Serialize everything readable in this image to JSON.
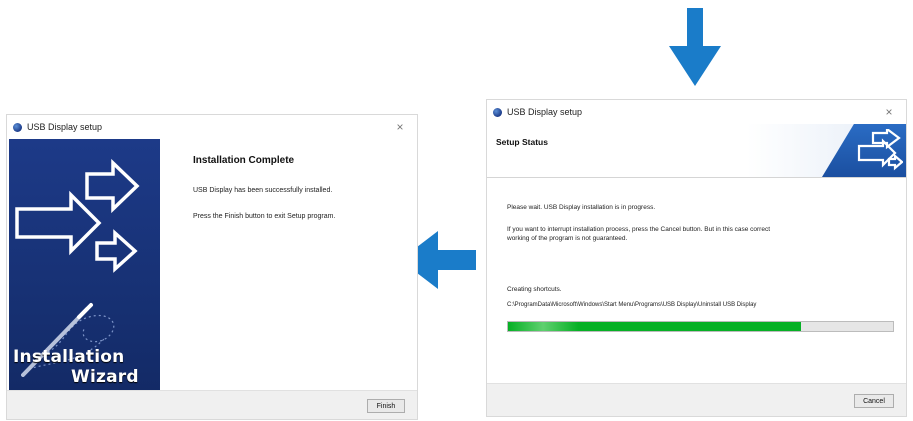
{
  "install_complete_dialog": {
    "title": "USB Display setup",
    "close_glyph": "×",
    "heading": "Installation Complete",
    "message": "USB Display has been successfully installed.",
    "instruction": "Press the Finish button to exit Setup program.",
    "banner_line1": "Installation",
    "banner_line2": "Wizard",
    "finish_label": "Finish"
  },
  "setup_status_dialog": {
    "title": "USB Display setup",
    "close_glyph": "×",
    "header_title": "Setup Status",
    "wait_message": "Please wait. USB Display installation is in progress.",
    "cancel_note_line1": "If you want to interrupt installation process, press the Cancel button. But in this case correct",
    "cancel_note_line2": "working of the program is not guaranteed.",
    "current_action": "Creating shortcuts.",
    "current_path": "C:\\ProgramData\\Microsoft\\Windows\\Start Menu\\Programs\\USB Display\\Uninstall USB Display",
    "progress_fraction": 0.76,
    "cancel_label": "Cancel"
  },
  "colors": {
    "flow_arrow": "#1a7cc9",
    "banner_blue": "#1d3a88",
    "progress_green": "#06b025"
  },
  "icons": {
    "flow_down": "arrow-down-icon",
    "flow_left": "arrow-left-icon"
  }
}
